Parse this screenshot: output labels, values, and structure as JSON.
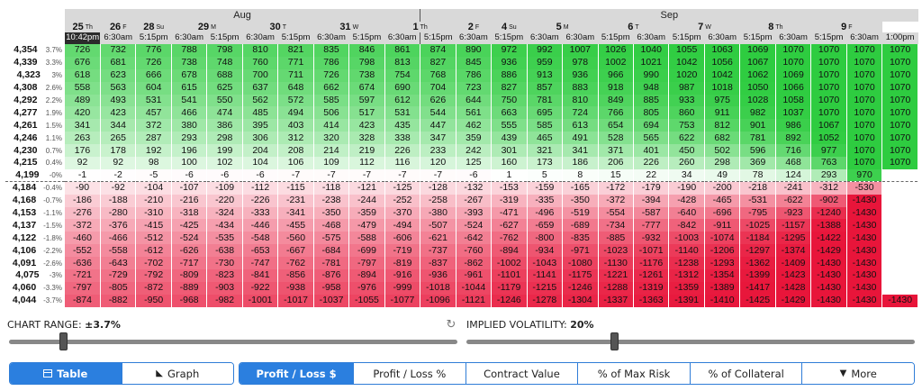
{
  "months": [
    {
      "label": "Aug",
      "span": 10
    },
    {
      "label": "Sep",
      "span": 14
    }
  ],
  "days": [
    {
      "num": "25",
      "dow": "Th",
      "span": 1
    },
    {
      "num": "26",
      "dow": "F",
      "span": 1
    },
    {
      "num": "28",
      "dow": "Su",
      "span": 1
    },
    {
      "num": "29",
      "dow": "M",
      "span": 2
    },
    {
      "num": "30",
      "dow": "T",
      "span": 2
    },
    {
      "num": "31",
      "dow": "W",
      "span": 2
    },
    {
      "num": "1",
      "dow": "Th",
      "span": 2
    },
    {
      "num": "2",
      "dow": "F",
      "span": 1
    },
    {
      "num": "4",
      "dow": "Su",
      "span": 1
    },
    {
      "num": "5",
      "dow": "M",
      "span": 2
    },
    {
      "num": "6",
      "dow": "T",
      "span": 2
    },
    {
      "num": "7",
      "dow": "W",
      "span": 2
    },
    {
      "num": "8",
      "dow": "Th",
      "span": 2
    },
    {
      "num": "9",
      "dow": "F",
      "span": 2
    }
  ],
  "times": [
    "10:42pm",
    "6:30am",
    "5:15pm",
    "6:30am",
    "5:15pm",
    "6:30am",
    "5:15pm",
    "6:30am",
    "5:15pm",
    "6:30am",
    "5:15pm",
    "6:30am",
    "5:15pm",
    "6:30am",
    "6:30am",
    "5:15pm",
    "6:30am",
    "5:15pm",
    "6:30am",
    "5:15pm",
    "6:30am",
    "5:15pm",
    "6:30am",
    "1:00pm"
  ],
  "rows": [
    {
      "price": "4,354",
      "pct": "3.7%",
      "values": [
        726,
        732,
        776,
        788,
        798,
        810,
        821,
        835,
        846,
        861,
        874,
        890,
        972,
        992,
        1007,
        1026,
        1040,
        1055,
        1063,
        1069,
        1070,
        1070,
        1070,
        1070
      ]
    },
    {
      "price": "4,339",
      "pct": "3.3%",
      "values": [
        676,
        681,
        726,
        738,
        748,
        760,
        771,
        786,
        798,
        813,
        827,
        845,
        936,
        959,
        978,
        1002,
        1021,
        1042,
        1056,
        1067,
        1070,
        1070,
        1070,
        1070
      ]
    },
    {
      "price": "4,323",
      "pct": "3%",
      "values": [
        618,
        623,
        666,
        678,
        688,
        700,
        711,
        726,
        738,
        754,
        768,
        786,
        886,
        913,
        936,
        966,
        990,
        1020,
        1042,
        1062,
        1069,
        1070,
        1070,
        1070
      ]
    },
    {
      "price": "4,308",
      "pct": "2.6%",
      "values": [
        558,
        563,
        604,
        615,
        625,
        637,
        648,
        662,
        674,
        690,
        704,
        723,
        827,
        857,
        883,
        918,
        948,
        987,
        1018,
        1050,
        1066,
        1070,
        1070,
        1070
      ]
    },
    {
      "price": "4,292",
      "pct": "2.2%",
      "values": [
        489,
        493,
        531,
        541,
        550,
        562,
        572,
        585,
        597,
        612,
        626,
        644,
        750,
        781,
        810,
        849,
        885,
        933,
        975,
        1028,
        1058,
        1070,
        1070,
        1070
      ]
    },
    {
      "price": "4,277",
      "pct": "1.9%",
      "values": [
        420,
        423,
        457,
        466,
        474,
        485,
        494,
        506,
        517,
        531,
        544,
        561,
        663,
        695,
        724,
        766,
        805,
        860,
        911,
        982,
        1037,
        1070,
        1070,
        1070
      ]
    },
    {
      "price": "4,261",
      "pct": "1.5%",
      "values": [
        341,
        344,
        372,
        380,
        386,
        395,
        403,
        414,
        423,
        435,
        447,
        462,
        555,
        585,
        613,
        654,
        694,
        753,
        812,
        901,
        986,
        1067,
        1070,
        1070
      ]
    },
    {
      "price": "4,246",
      "pct": "1.1%",
      "values": [
        263,
        265,
        287,
        293,
        298,
        306,
        312,
        320,
        328,
        338,
        347,
        359,
        439,
        465,
        491,
        528,
        565,
        622,
        682,
        781,
        892,
        1052,
        1070,
        1070
      ]
    },
    {
      "price": "4,230",
      "pct": "0.7%",
      "values": [
        176,
        178,
        192,
        196,
        199,
        204,
        208,
        214,
        219,
        226,
        233,
        242,
        301,
        321,
        341,
        371,
        401,
        450,
        502,
        596,
        716,
        977,
        1070,
        1070
      ]
    },
    {
      "price": "4,215",
      "pct": "0.4%",
      "values": [
        92,
        92,
        98,
        100,
        102,
        104,
        106,
        109,
        112,
        116,
        120,
        125,
        160,
        173,
        186,
        206,
        226,
        260,
        298,
        369,
        468,
        763,
        1070,
        1070
      ]
    },
    {
      "price": "4,199",
      "pct": "-0%",
      "values": [
        -1,
        -2,
        -5,
        -6,
        -6,
        -6,
        -7,
        -7,
        -7,
        -7,
        -7,
        -6,
        1,
        5,
        8,
        15,
        22,
        34,
        49,
        78,
        124,
        293,
        970,
        null
      ]
    },
    {
      "price": "4,184",
      "pct": "-0.4%",
      "values": [
        -90,
        -92,
        -104,
        -107,
        -109,
        -112,
        -115,
        -118,
        -121,
        -125,
        -128,
        -132,
        -153,
        -159,
        -165,
        -172,
        -179,
        -190,
        -200,
        -218,
        -241,
        -312,
        -530,
        null
      ]
    },
    {
      "price": "4,168",
      "pct": "-0.7%",
      "values": [
        -186,
        -188,
        -210,
        -216,
        -220,
        -226,
        -231,
        -238,
        -244,
        -252,
        -258,
        -267,
        -319,
        -335,
        -350,
        -372,
        -394,
        -428,
        -465,
        -531,
        -622,
        -902,
        -1430,
        null
      ]
    },
    {
      "price": "4,153",
      "pct": "-1.1%",
      "values": [
        -276,
        -280,
        -310,
        -318,
        -324,
        -333,
        -341,
        -350,
        -359,
        -370,
        -380,
        -393,
        -471,
        -496,
        -519,
        -554,
        -587,
        -640,
        -696,
        -795,
        -923,
        -1240,
        -1430,
        null
      ]
    },
    {
      "price": "4,137",
      "pct": "-1.5%",
      "values": [
        -372,
        -376,
        -415,
        -425,
        -434,
        -446,
        -455,
        -468,
        -479,
        -494,
        -507,
        -524,
        -627,
        -659,
        -689,
        -734,
        -777,
        -842,
        -911,
        -1025,
        -1157,
        -1388,
        -1430,
        null
      ]
    },
    {
      "price": "4,122",
      "pct": "-1.8%",
      "values": [
        -460,
        -466,
        -512,
        -524,
        -535,
        -548,
        -560,
        -575,
        -588,
        -606,
        -621,
        -642,
        -762,
        -800,
        -835,
        -885,
        -932,
        -1003,
        -1074,
        -1184,
        -1295,
        -1422,
        -1430,
        null
      ]
    },
    {
      "price": "4,106",
      "pct": "-2.2%",
      "values": [
        -552,
        -558,
        -612,
        -626,
        -638,
        -653,
        -667,
        -684,
        -699,
        -719,
        -737,
        -760,
        -894,
        -934,
        -971,
        -1023,
        -1071,
        -1140,
        -1206,
        -1297,
        -1374,
        -1429,
        -1430,
        null
      ]
    },
    {
      "price": "4,091",
      "pct": "-2.6%",
      "values": [
        -636,
        -643,
        -702,
        -717,
        -730,
        -747,
        -762,
        -781,
        -797,
        -819,
        -837,
        -862,
        -1002,
        -1043,
        -1080,
        -1130,
        -1176,
        -1238,
        -1293,
        -1362,
        -1409,
        -1430,
        -1430,
        null
      ]
    },
    {
      "price": "4,075",
      "pct": "-3%",
      "values": [
        -721,
        -729,
        -792,
        -809,
        -823,
        -841,
        -856,
        -876,
        -894,
        -916,
        -936,
        -961,
        -1101,
        -1141,
        -1175,
        -1221,
        -1261,
        -1312,
        -1354,
        -1399,
        -1423,
        -1430,
        -1430,
        null
      ]
    },
    {
      "price": "4,060",
      "pct": "-3.3%",
      "values": [
        -797,
        -805,
        -872,
        -889,
        -903,
        -922,
        -938,
        -958,
        -976,
        -999,
        -1018,
        -1044,
        -1179,
        -1215,
        -1246,
        -1288,
        -1319,
        -1359,
        -1389,
        -1417,
        -1428,
        -1430,
        -1430,
        null
      ]
    },
    {
      "price": "4,044",
      "pct": "-3.7%",
      "values": [
        -874,
        -882,
        -950,
        -968,
        -982,
        -1001,
        -1017,
        -1037,
        -1055,
        -1077,
        -1096,
        -1121,
        -1246,
        -1278,
        -1304,
        -1337,
        -1363,
        -1391,
        -1410,
        -1425,
        -1429,
        -1430,
        -1430,
        -1430
      ]
    }
  ],
  "color_scale": {
    "max_profit": 1070,
    "max_loss": -1430,
    "profit_color": "#2ecc40",
    "loss_color": "#e8153a"
  },
  "chart_range": {
    "label": "CHART RANGE:",
    "value": "±3.7%",
    "level": 0.12
  },
  "implied_volatility": {
    "label": "IMPLIED VOLATILITY:",
    "value": "20%",
    "level": 0.33
  },
  "reset_icon": "reset-icon",
  "view_tabs": [
    {
      "label": "Table",
      "icon": "table-icon",
      "active": true
    },
    {
      "label": "Graph",
      "icon": "graph-icon",
      "active": false
    }
  ],
  "metric_tabs": [
    {
      "label": "Profit / Loss $",
      "active": true
    },
    {
      "label": "Profit / Loss %",
      "active": false
    },
    {
      "label": "Contract Value",
      "active": false
    },
    {
      "label": "% of Max Risk",
      "active": false
    },
    {
      "label": "% of Collateral",
      "active": false
    },
    {
      "label": "More",
      "icon": "caret-down-icon",
      "active": false
    }
  ]
}
